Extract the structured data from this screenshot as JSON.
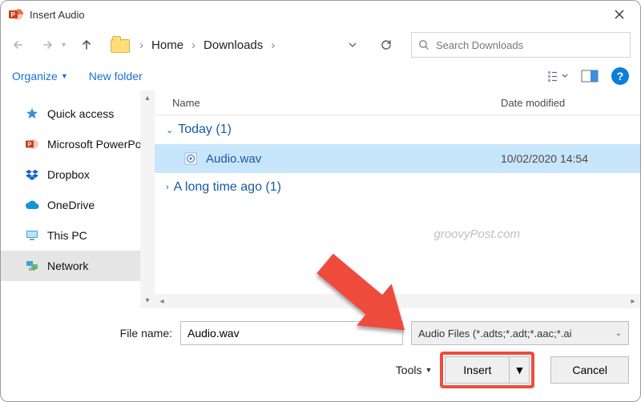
{
  "title": "Insert Audio",
  "breadcrumb": {
    "root_caret": "›",
    "items": [
      "Home",
      "Downloads"
    ]
  },
  "search": {
    "placeholder": "Search Downloads"
  },
  "toolbar": {
    "organize": "Organize",
    "new_folder": "New folder"
  },
  "columns": {
    "name": "Name",
    "date": "Date modified"
  },
  "sidebar": {
    "items": [
      {
        "label": "Quick access"
      },
      {
        "label": "Microsoft PowerPo"
      },
      {
        "label": "Dropbox"
      },
      {
        "label": "OneDrive"
      },
      {
        "label": "This PC"
      },
      {
        "label": "Network"
      }
    ]
  },
  "groups": {
    "today": {
      "label": "Today (1)",
      "expanded": true
    },
    "long_ago": {
      "label": "A long time ago (1)",
      "expanded": false
    }
  },
  "files": {
    "today": [
      {
        "name": "Audio.wav",
        "date": "10/02/2020 14:54",
        "selected": true
      }
    ]
  },
  "watermark": "groovyPost.com",
  "footer": {
    "filename_label": "File name:",
    "filename_value": "Audio.wav",
    "filetype_label": "Audio Files (*.adts;*.adt;*.aac;*.ai",
    "tools": "Tools",
    "insert": "Insert",
    "cancel": "Cancel"
  }
}
